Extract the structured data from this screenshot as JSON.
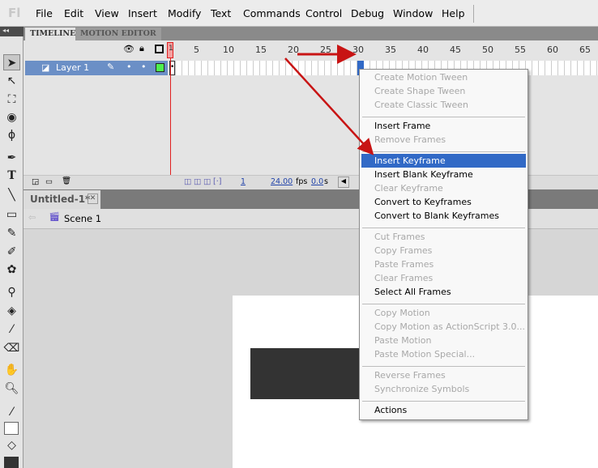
{
  "app": {
    "logo": "Fl"
  },
  "menu": [
    "File",
    "Edit",
    "View",
    "Insert",
    "Modify",
    "Text",
    "Commands",
    "Control",
    "Debug",
    "Window",
    "Help"
  ],
  "timeline": {
    "tabs": [
      "TIMELINE",
      "MOTION EDITOR"
    ],
    "ruler": [
      "1",
      "5",
      "10",
      "15",
      "20",
      "25",
      "30",
      "35",
      "40",
      "45",
      "50",
      "55",
      "60",
      "65"
    ],
    "layer": "Layer 1",
    "current_frame": "1",
    "fps": "24.00",
    "fps_unit": "fps",
    "time": "0.0",
    "time_unit": "s"
  },
  "document": {
    "tab": "Untitled-1*",
    "scene": "Scene 1"
  },
  "context_menu": [
    {
      "label": "Create Motion Tween",
      "enabled": false
    },
    {
      "label": "Create Shape Tween",
      "enabled": false
    },
    {
      "label": "Create Classic Tween",
      "enabled": false
    },
    {
      "sep": true
    },
    {
      "label": "Insert Frame",
      "enabled": true
    },
    {
      "label": "Remove Frames",
      "enabled": false
    },
    {
      "sep": true
    },
    {
      "label": "Insert Keyframe",
      "enabled": true,
      "highlighted": true
    },
    {
      "label": "Insert Blank Keyframe",
      "enabled": true
    },
    {
      "label": "Clear Keyframe",
      "enabled": false
    },
    {
      "label": "Convert to Keyframes",
      "enabled": true
    },
    {
      "label": "Convert to Blank Keyframes",
      "enabled": true
    },
    {
      "sep": true
    },
    {
      "label": "Cut Frames",
      "enabled": false
    },
    {
      "label": "Copy Frames",
      "enabled": false
    },
    {
      "label": "Paste Frames",
      "enabled": false
    },
    {
      "label": "Clear Frames",
      "enabled": false
    },
    {
      "label": "Select All Frames",
      "enabled": true
    },
    {
      "sep": true
    },
    {
      "label": "Copy Motion",
      "enabled": false
    },
    {
      "label": "Copy Motion as ActionScript 3.0...",
      "enabled": false
    },
    {
      "label": "Paste Motion",
      "enabled": false
    },
    {
      "label": "Paste Motion Special...",
      "enabled": false
    },
    {
      "sep": true
    },
    {
      "label": "Reverse Frames",
      "enabled": false
    },
    {
      "label": "Synchronize Symbols",
      "enabled": false
    },
    {
      "sep": true
    },
    {
      "label": "Actions",
      "enabled": true
    }
  ],
  "colors": {
    "highlight": "#3169c6",
    "layer_selected": "#6b8fc6",
    "playhead": "#e02020",
    "annotation_arrow": "#c81414"
  }
}
